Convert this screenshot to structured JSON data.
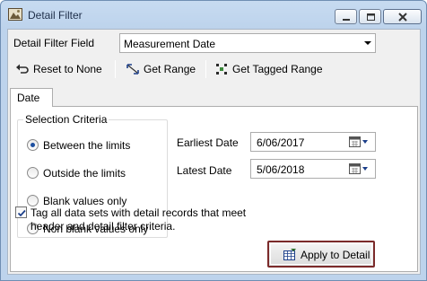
{
  "window": {
    "title": "Detail Filter",
    "icon": "app-image-icon",
    "controls": [
      "minimize-icon",
      "maximize-icon",
      "close-icon"
    ]
  },
  "filter_field": {
    "label": "Detail Filter Field",
    "value": "Measurement Date"
  },
  "toolbar": {
    "reset_label": "Reset to None",
    "get_range_label": "Get Range",
    "get_tagged_label": "Get Tagged Range"
  },
  "tabs": [
    {
      "label": "Date",
      "selected": true
    }
  ],
  "selection": {
    "legend": "Selection Criteria",
    "options": [
      {
        "label": "Between the limits",
        "selected": true
      },
      {
        "label": "Outside the limits",
        "selected": false
      },
      {
        "label": "Blank values only",
        "selected": false
      },
      {
        "label": "Non blank values only",
        "selected": false
      }
    ]
  },
  "dates": {
    "earliest_label": "Earliest Date",
    "earliest_value": "6/06/2017",
    "latest_label": "Latest Date",
    "latest_value": "5/06/2018"
  },
  "tag_checkbox": {
    "checked": true,
    "label": "Tag all data sets with detail records that meet header and detail filter criteria."
  },
  "apply_button": {
    "label": "Apply to Detail"
  },
  "colors": {
    "title_bar": "#c7dbf1",
    "radio_dot": "#1c4fa0",
    "apply_border": "#7b2a2a"
  }
}
